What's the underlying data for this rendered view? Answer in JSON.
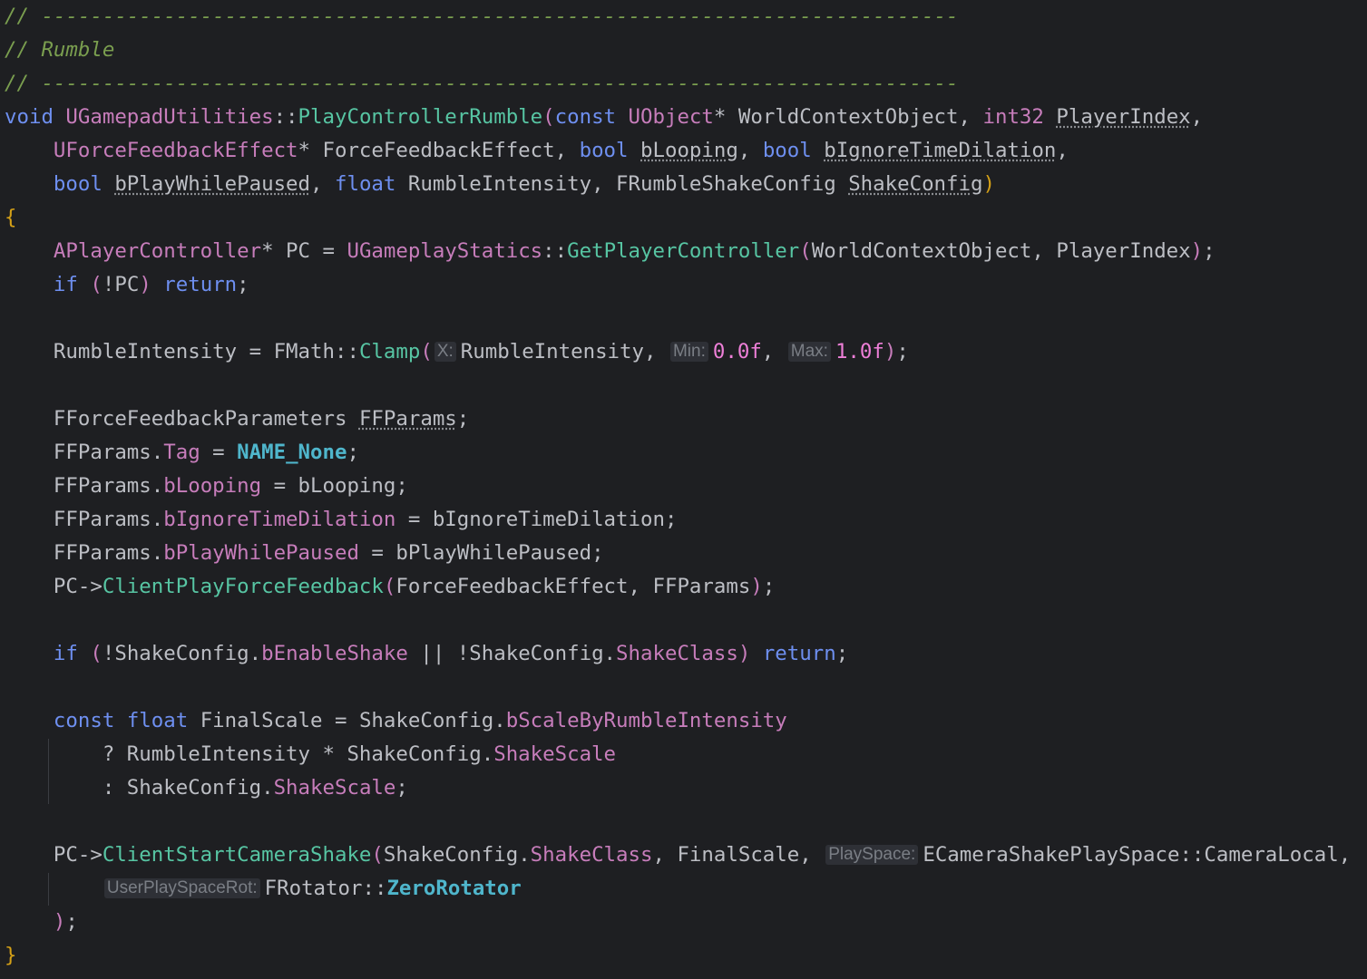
{
  "colors": {
    "background": "#1e1f22",
    "plain": "#bcbec4",
    "comment": "#7a9e4f",
    "keyword": "#6e8ff0",
    "type": "#c77dbb",
    "function": "#57c5a3",
    "number": "#ee7fd8",
    "macro": "#4fb6cc",
    "brace": "#d4a017",
    "inlay_hint": "#7a7e85"
  },
  "lines": [
    [
      {
        "t": "// ---------------------------------------------------------------------------",
        "c": "comment"
      }
    ],
    [
      {
        "t": "// Rumble",
        "c": "comment"
      }
    ],
    [
      {
        "t": "// ---------------------------------------------------------------------------",
        "c": "comment"
      }
    ],
    [
      {
        "t": "void",
        "c": "kw"
      },
      {
        "t": " ",
        "c": "plain"
      },
      {
        "t": "UGamepadUtilities",
        "c": "type"
      },
      {
        "t": "::",
        "c": "punc"
      },
      {
        "t": "PlayControllerRumble",
        "c": "func"
      },
      {
        "t": "(",
        "c": "paren"
      },
      {
        "t": "const",
        "c": "kw"
      },
      {
        "t": " ",
        "c": "plain"
      },
      {
        "t": "UObject",
        "c": "type"
      },
      {
        "t": "* WorldContextObject, ",
        "c": "plain"
      },
      {
        "t": "int32",
        "c": "type"
      },
      {
        "t": " ",
        "c": "plain"
      },
      {
        "t": "PlayerIndex",
        "c": "unused"
      },
      {
        "t": ",",
        "c": "punc"
      }
    ],
    [
      {
        "t": "    ",
        "c": "plain"
      },
      {
        "t": "UForceFeedbackEffect",
        "c": "type"
      },
      {
        "t": "* ForceFeedbackEffect, ",
        "c": "plain"
      },
      {
        "t": "bool",
        "c": "kw"
      },
      {
        "t": " ",
        "c": "plain"
      },
      {
        "t": "bLooping",
        "c": "unused"
      },
      {
        "t": ", ",
        "c": "plain"
      },
      {
        "t": "bool",
        "c": "kw"
      },
      {
        "t": " ",
        "c": "plain"
      },
      {
        "t": "bIgnoreTimeDilation",
        "c": "unused"
      },
      {
        "t": ",",
        "c": "punc"
      }
    ],
    [
      {
        "t": "    ",
        "c": "plain"
      },
      {
        "t": "bool",
        "c": "kw"
      },
      {
        "t": " ",
        "c": "plain"
      },
      {
        "t": "bPlayWhilePaused",
        "c": "unused"
      },
      {
        "t": ", ",
        "c": "plain"
      },
      {
        "t": "float",
        "c": "kw"
      },
      {
        "t": " RumbleIntensity, ",
        "c": "plain"
      },
      {
        "t": "FRumbleShakeConfig",
        "c": "plain"
      },
      {
        "t": " ",
        "c": "plain"
      },
      {
        "t": "ShakeConfig",
        "c": "unused"
      },
      {
        "t": ")",
        "c": "brace"
      }
    ],
    [
      {
        "t": "{",
        "c": "brace"
      }
    ],
    [
      {
        "t": "    ",
        "c": "plain"
      },
      {
        "t": "APlayerController",
        "c": "type"
      },
      {
        "t": "* PC = ",
        "c": "plain"
      },
      {
        "t": "UGameplayStatics",
        "c": "type"
      },
      {
        "t": "::",
        "c": "punc"
      },
      {
        "t": "GetPlayerController",
        "c": "func"
      },
      {
        "t": "(",
        "c": "paren"
      },
      {
        "t": "WorldContextObject, PlayerIndex",
        "c": "plain"
      },
      {
        "t": ")",
        "c": "paren"
      },
      {
        "t": ";",
        "c": "punc"
      }
    ],
    [
      {
        "t": "    ",
        "c": "plain"
      },
      {
        "t": "if",
        "c": "kw"
      },
      {
        "t": " ",
        "c": "plain"
      },
      {
        "t": "(",
        "c": "paren"
      },
      {
        "t": "!PC",
        "c": "plain"
      },
      {
        "t": ")",
        "c": "paren"
      },
      {
        "t": " ",
        "c": "plain"
      },
      {
        "t": "return",
        "c": "kw"
      },
      {
        "t": ";",
        "c": "punc"
      }
    ],
    [],
    [
      {
        "t": "    RumbleIntensity = ",
        "c": "plain"
      },
      {
        "t": "FMath",
        "c": "plain"
      },
      {
        "t": "::",
        "c": "punc"
      },
      {
        "t": "Clamp",
        "c": "func"
      },
      {
        "t": "(",
        "c": "paren"
      },
      {
        "hint": "X:"
      },
      {
        "t": "RumbleIntensity, ",
        "c": "plain"
      },
      {
        "hint": "Min:"
      },
      {
        "t": "0.0f",
        "c": "num"
      },
      {
        "t": ", ",
        "c": "plain"
      },
      {
        "hint": "Max:"
      },
      {
        "t": "1.0f",
        "c": "num"
      },
      {
        "t": ")",
        "c": "paren"
      },
      {
        "t": ";",
        "c": "punc"
      }
    ],
    [],
    [
      {
        "t": "    ",
        "c": "plain"
      },
      {
        "t": "FForceFeedbackParameters",
        "c": "plain"
      },
      {
        "t": " ",
        "c": "plain"
      },
      {
        "t": "FFParams",
        "c": "unused"
      },
      {
        "t": ";",
        "c": "punc"
      }
    ],
    [
      {
        "t": "    FFParams.",
        "c": "plain"
      },
      {
        "t": "Tag",
        "c": "field"
      },
      {
        "t": " = ",
        "c": "plain"
      },
      {
        "t": "NAME_None",
        "c": "macro"
      },
      {
        "t": ";",
        "c": "punc"
      }
    ],
    [
      {
        "t": "    FFParams.",
        "c": "plain"
      },
      {
        "t": "bLooping",
        "c": "field"
      },
      {
        "t": " = bLooping;",
        "c": "plain"
      }
    ],
    [
      {
        "t": "    FFParams.",
        "c": "plain"
      },
      {
        "t": "bIgnoreTimeDilation",
        "c": "field"
      },
      {
        "t": " = bIgnoreTimeDilation;",
        "c": "plain"
      }
    ],
    [
      {
        "t": "    FFParams.",
        "c": "plain"
      },
      {
        "t": "bPlayWhilePaused",
        "c": "field"
      },
      {
        "t": " = bPlayWhilePaused;",
        "c": "plain"
      }
    ],
    [
      {
        "t": "    PC->",
        "c": "plain"
      },
      {
        "t": "ClientPlayForceFeedback",
        "c": "func"
      },
      {
        "t": "(",
        "c": "paren"
      },
      {
        "t": "ForceFeedbackEffect, FFParams",
        "c": "plain"
      },
      {
        "t": ")",
        "c": "paren"
      },
      {
        "t": ";",
        "c": "punc"
      }
    ],
    [],
    [
      {
        "t": "    ",
        "c": "plain"
      },
      {
        "t": "if",
        "c": "kw"
      },
      {
        "t": " ",
        "c": "plain"
      },
      {
        "t": "(",
        "c": "paren"
      },
      {
        "t": "!ShakeConfig.",
        "c": "plain"
      },
      {
        "t": "bEnableShake",
        "c": "field"
      },
      {
        "t": " || !ShakeConfig.",
        "c": "plain"
      },
      {
        "t": "ShakeClass",
        "c": "field"
      },
      {
        "t": ")",
        "c": "paren"
      },
      {
        "t": " ",
        "c": "plain"
      },
      {
        "t": "return",
        "c": "kw"
      },
      {
        "t": ";",
        "c": "punc"
      }
    ],
    [],
    [
      {
        "t": "    ",
        "c": "plain"
      },
      {
        "t": "const",
        "c": "kw"
      },
      {
        "t": " ",
        "c": "plain"
      },
      {
        "t": "float",
        "c": "kw"
      },
      {
        "t": " FinalScale = ShakeConfig.",
        "c": "plain"
      },
      {
        "t": "bScaleByRumbleIntensity",
        "c": "field"
      }
    ],
    [
      {
        "t": "        ? RumbleIntensity * ShakeConfig.",
        "c": "plain"
      },
      {
        "t": "ShakeScale",
        "c": "field"
      }
    ],
    [
      {
        "t": "        : ShakeConfig.",
        "c": "plain"
      },
      {
        "t": "ShakeScale",
        "c": "field"
      },
      {
        "t": ";",
        "c": "punc"
      }
    ],
    [],
    [
      {
        "t": "    PC->",
        "c": "plain"
      },
      {
        "t": "ClientStartCameraShake",
        "c": "func"
      },
      {
        "t": "(",
        "c": "paren"
      },
      {
        "t": "ShakeConfig.",
        "c": "plain"
      },
      {
        "t": "ShakeClass",
        "c": "field"
      },
      {
        "t": ", FinalScale, ",
        "c": "plain"
      },
      {
        "hint": "PlaySpace:"
      },
      {
        "t": "ECameraShakePlaySpace",
        "c": "plain"
      },
      {
        "t": "::",
        "c": "punc"
      },
      {
        "t": "CameraLocal",
        "c": "plain"
      },
      {
        "t": ",",
        "c": "punc"
      }
    ],
    [
      {
        "t": "        ",
        "c": "plain"
      },
      {
        "hint": "UserPlaySpaceRot:"
      },
      {
        "t": "FRotator",
        "c": "plain"
      },
      {
        "t": "::",
        "c": "punc"
      },
      {
        "t": "ZeroRotator",
        "c": "macro"
      }
    ],
    [
      {
        "t": "    ",
        "c": "plain"
      },
      {
        "t": ")",
        "c": "paren"
      },
      {
        "t": ";",
        "c": "punc"
      }
    ],
    [
      {
        "t": "}",
        "c": "brace"
      }
    ]
  ]
}
